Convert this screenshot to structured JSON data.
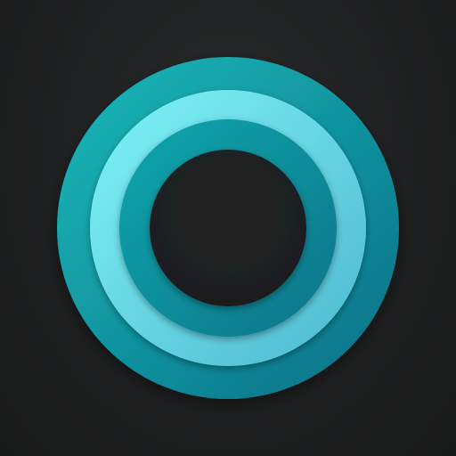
{
  "app_icon": {
    "icon": "concentric-rings-icon",
    "colors": {
      "background": "#1c1d1e",
      "outer_ring_light": "#17b9b9",
      "outer_ring_dark": "#0b6f86",
      "middle_ring_light": "#7ef3f6",
      "middle_ring_dark": "#4fb8cf",
      "inner_ring_light": "#12a7ae",
      "inner_ring_dark": "#0b7488",
      "hole": "#1d1e1f"
    }
  }
}
